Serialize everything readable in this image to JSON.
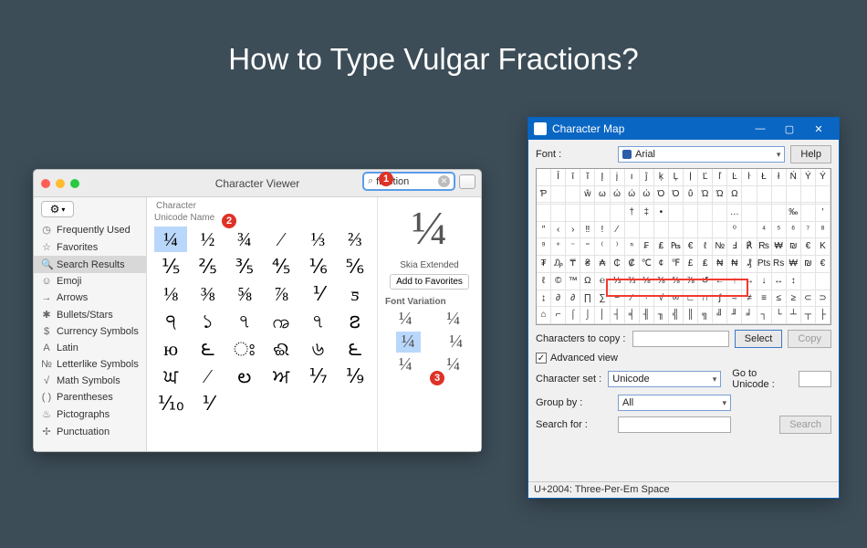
{
  "page": {
    "title": "How to Type Vulgar Fractions?"
  },
  "badges": [
    "1",
    "2",
    "3"
  ],
  "mac": {
    "window_title": "Character Viewer",
    "search": {
      "value": "fraction",
      "clear_label": "clear"
    },
    "sidebar": [
      {
        "icon": "◷",
        "label": "Frequently Used"
      },
      {
        "icon": "☆",
        "label": "Favorites"
      },
      {
        "icon": "🔍",
        "label": "Search Results",
        "selected": true
      },
      {
        "icon": "☺",
        "label": "Emoji"
      },
      {
        "icon": "→",
        "label": "Arrows"
      },
      {
        "icon": "✱",
        "label": "Bullets/Stars"
      },
      {
        "icon": "$",
        "label": "Currency Symbols"
      },
      {
        "icon": "A",
        "label": "Latin"
      },
      {
        "icon": "№",
        "label": "Letterlike Symbols"
      },
      {
        "icon": "√",
        "label": "Math Symbols"
      },
      {
        "icon": "( )",
        "label": "Parentheses"
      },
      {
        "icon": "♨",
        "label": "Pictographs"
      },
      {
        "icon": "✢",
        "label": "Punctuation"
      }
    ],
    "grid_headers": {
      "col1": "Character",
      "col2": "Unicode Name"
    },
    "grid": [
      "¼",
      "½",
      "¾",
      "⁄",
      "⅓",
      "⅔",
      "⅕",
      "⅖",
      "⅗",
      "⅘",
      "⅙",
      "⅚",
      "⅛",
      "⅜",
      "⅝",
      "⅞",
      "⅟",
      "ƽ",
      "੧",
      "১",
      "৭",
      "ꩠ",
      "৭",
      "౭",
      "ю",
      "౬",
      "ਃ",
      "ଈ",
      "৬",
      "౬",
      "ਘ",
      "⁄",
      "ల",
      "ਅ",
      "⅐",
      "⅑",
      "⅒",
      "⅟",
      "",
      "",
      "",
      ""
    ],
    "grid_selected_index": 0,
    "preview": {
      "big": "¼",
      "font_name": "Skia Extended",
      "add_label": "Add to Favorites",
      "variation_header": "Font Variation",
      "variations": [
        [
          "¼",
          "¼"
        ],
        [
          "¼",
          "¼"
        ],
        [
          "¼",
          "¼"
        ]
      ],
      "variation_selected": [
        1,
        0
      ]
    }
  },
  "win": {
    "window_title": "Character Map",
    "font_label": "Font :",
    "font_value": "Arial",
    "help_label": "Help",
    "grid_rows": [
      [
        " ",
        "Ī",
        "ī",
        "ĭ",
        "Į",
        "į",
        "ı",
        "ĵ",
        "ķ",
        "Ļ",
        "ļ",
        "Ľ",
        "ľ",
        "Ŀ",
        "ŀ",
        "Ł",
        "ł",
        "Ń",
        "Ý",
        "Ý"
      ],
      [
        "Ƥ",
        " ",
        " ",
        "ŵ",
        "ω",
        "ώ",
        "ώ",
        "ώ",
        "Ό",
        "Ό",
        "ΰ",
        "Ώ",
        "Ώ",
        "Ω",
        " ",
        " ",
        " ",
        " ",
        " ",
        " "
      ],
      [
        " ",
        " ",
        " ",
        " ",
        " ",
        " ",
        " ",
        " ",
        " ",
        " ",
        " ",
        " ",
        " ",
        " ",
        " ",
        " ",
        " ",
        " ",
        " ",
        " "
      ],
      [
        " ",
        " ",
        " ",
        " ",
        " ",
        " ",
        "†",
        "‡",
        "•",
        " ",
        " ",
        " ",
        " ",
        "…",
        " ",
        " ",
        " ",
        "‰",
        " ",
        "′"
      ],
      [
        "″",
        "‹",
        "›",
        "‼",
        "ǃ",
        "⁄",
        " ",
        " ",
        " ",
        " ",
        " ",
        " ",
        " ",
        "⁰",
        " ",
        "⁴",
        "⁵",
        "⁶",
        "⁷",
        "⁸"
      ],
      [
        "⁹",
        "⁺",
        "⁻",
        "⁼",
        "⁽",
        "⁾",
        "ⁿ",
        "₣",
        "₤",
        "₧",
        "€",
        "ℓ",
        "№",
        "Ⅎ",
        "℟",
        "₨",
        "₩",
        "₪",
        "€",
        "K"
      ],
      [
        "₮",
        "₯",
        "₸",
        "₴",
        "₳",
        "₵",
        "₡",
        "℃",
        "¢",
        "℉",
        "£",
        "₤",
        "₦",
        "₦",
        "₰",
        "Pts",
        "Rs",
        "₩",
        "₪",
        "€"
      ],
      [
        "ℓ",
        "©",
        "™",
        "Ω",
        "℮",
        "⅓",
        "⅔",
        "⅛",
        "⅜",
        "⅝",
        "⅞",
        "↺",
        "←",
        "↑",
        "→",
        "↓",
        "↔",
        "↕",
        " ",
        " "
      ],
      [
        "↨",
        "∂",
        "∂",
        "∏",
        "∑",
        "−",
        "∕",
        "∙",
        "√",
        "∞",
        "∟",
        "∩",
        "∫",
        "≈",
        "≠",
        "≡",
        "≤",
        "≥",
        "⊂",
        "⊃"
      ],
      [
        "⌂",
        "⌐",
        "⌠",
        "⌡",
        "│",
        "┤",
        "╡",
        "╢",
        "╖",
        "╣",
        "║",
        "╗",
        "╝",
        "╜",
        "╛",
        "┐",
        "└",
        "┴",
        "┬",
        "├"
      ]
    ],
    "chars_to_copy_label": "Characters to copy :",
    "chars_to_copy_value": "",
    "select_label": "Select",
    "copy_label": "Copy",
    "advanced_label": "Advanced view",
    "advanced_checked": true,
    "charset_label": "Character set :",
    "charset_value": "Unicode",
    "goto_label": "Go to Unicode :",
    "goto_value": "",
    "group_label": "Group by :",
    "group_value": "All",
    "search_label": "Search for :",
    "search_value": "",
    "search_btn": "Search",
    "status": "U+2004: Three-Per-Em Space"
  }
}
